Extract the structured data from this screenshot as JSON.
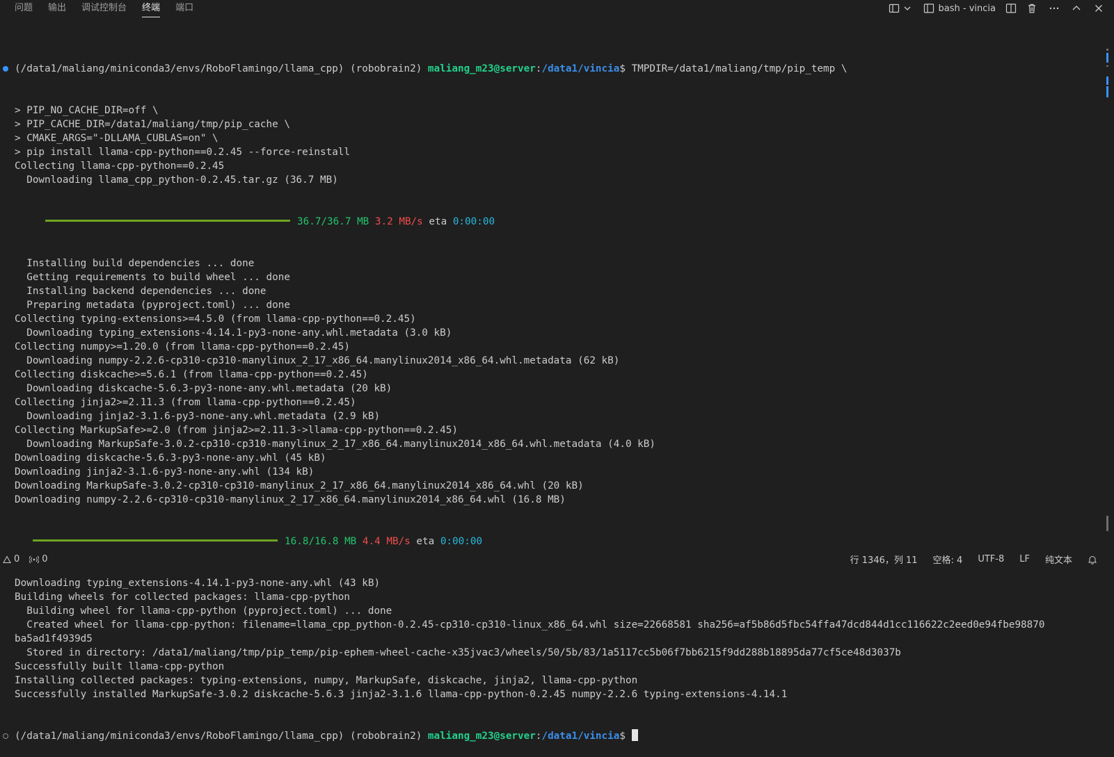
{
  "panel": {
    "tabs": [
      {
        "label": "问题",
        "active": false
      },
      {
        "label": "输出",
        "active": false
      },
      {
        "label": "调试控制台",
        "active": false
      },
      {
        "label": "终端",
        "active": true
      },
      {
        "label": "端口",
        "active": false
      }
    ],
    "terminal_name": "bash - vincia",
    "actions_icons": [
      "split-layout-icon",
      "chevron-down-icon",
      "terminal-icon",
      "split-terminal-icon",
      "trash-icon",
      "more-icon",
      "maximize-icon",
      "close-icon"
    ]
  },
  "terminal": {
    "prompt": {
      "path_prefix": "(/data1/maliang/miniconda3/envs/RoboFlamingo/llama_cpp) (robobrain2) ",
      "user_host": "maliang_m23@server",
      "colon": ":",
      "cwd": "/data1/vincia",
      "dollar": "$ "
    },
    "command_first": "TMPDIR=/data1/maliang/tmp/pip_temp \\",
    "lines_a": [
      "> PIP_NO_CACHE_DIR=off \\",
      "> PIP_CACHE_DIR=/data1/maliang/tmp/pip_cache \\",
      "> CMAKE_ARGS=\"-DLLAMA_CUBLAS=on\" \\",
      "> pip install llama-cpp-python==0.2.45 --force-reinstall",
      "Collecting llama-cpp-python==0.2.45",
      "  Downloading llama_cpp_python-0.2.45.tar.gz (36.7 MB)"
    ],
    "progress1": {
      "size": "36.7/36.7 MB",
      "speed": "3.2 MB/s",
      "eta_label": "eta",
      "eta": "0:00:00",
      "fraction": 1.0
    },
    "lines_b": [
      "  Installing build dependencies ... done",
      "  Getting requirements to build wheel ... done",
      "  Installing backend dependencies ... done",
      "  Preparing metadata (pyproject.toml) ... done",
      "Collecting typing-extensions>=4.5.0 (from llama-cpp-python==0.2.45)",
      "  Downloading typing_extensions-4.14.1-py3-none-any.whl.metadata (3.0 kB)",
      "Collecting numpy>=1.20.0 (from llama-cpp-python==0.2.45)",
      "  Downloading numpy-2.2.6-cp310-cp310-manylinux_2_17_x86_64.manylinux2014_x86_64.whl.metadata (62 kB)",
      "Collecting diskcache>=5.6.1 (from llama-cpp-python==0.2.45)",
      "  Downloading diskcache-5.6.3-py3-none-any.whl.metadata (20 kB)",
      "Collecting jinja2>=2.11.3 (from llama-cpp-python==0.2.45)",
      "  Downloading jinja2-3.1.6-py3-none-any.whl.metadata (2.9 kB)",
      "Collecting MarkupSafe>=2.0 (from jinja2>=2.11.3->llama-cpp-python==0.2.45)",
      "  Downloading MarkupSafe-3.0.2-cp310-cp310-manylinux_2_17_x86_64.manylinux2014_x86_64.whl.metadata (4.0 kB)",
      "Downloading diskcache-5.6.3-py3-none-any.whl (45 kB)",
      "Downloading jinja2-3.1.6-py3-none-any.whl (134 kB)",
      "Downloading MarkupSafe-3.0.2-cp310-cp310-manylinux_2_17_x86_64.manylinux2014_x86_64.whl (20 kB)",
      "Downloading numpy-2.2.6-cp310-cp310-manylinux_2_17_x86_64.manylinux2014_x86_64.whl (16.8 MB)"
    ],
    "progress2": {
      "size": "16.8/16.8 MB",
      "speed": "4.4 MB/s",
      "eta_label": "eta",
      "eta": "0:00:00",
      "fraction": 1.0
    },
    "lines_c": [
      "Downloading typing_extensions-4.14.1-py3-none-any.whl (43 kB)",
      "Building wheels for collected packages: llama-cpp-python",
      "  Building wheel for llama-cpp-python (pyproject.toml) ... done",
      "  Created wheel for llama-cpp-python: filename=llama_cpp_python-0.2.45-cp310-cp310-linux_x86_64.whl size=22668581 sha256=af5b86d5fbc54ffa47dcd844d1cc116622c2eed0e94fbe98870",
      "ba5ad1f4939d5",
      "  Stored in directory: /data1/maliang/tmp/pip_temp/pip-ephem-wheel-cache-x35jvac3/wheels/50/5b/83/1a5117cc5b06f7bb6215f9dd288b18895da77cf5ce48d3037b",
      "Successfully built llama-cpp-python",
      "Installing collected packages: typing-extensions, numpy, MarkupSafe, diskcache, jinja2, llama-cpp-python",
      "Successfully installed MarkupSafe-3.0.2 diskcache-5.6.3 jinja2-3.1.6 llama-cpp-python-0.2.45 numpy-2.2.6 typing-extensions-4.14.1"
    ]
  },
  "statusbar": {
    "errors": "0",
    "warnings": "0",
    "position": "行 1346，列 11",
    "spaces": "空格: 4",
    "encoding": "UTF-8",
    "eol": "LF",
    "language": "纯文本"
  },
  "colors": {
    "background": "#1f1f1f",
    "user_host_green": "#23d18b",
    "cwd_blue": "#3b8eea",
    "progress_bar": "#6ea51f",
    "speed_red": "#f14c4c",
    "eta_cyan": "#29b8db"
  }
}
